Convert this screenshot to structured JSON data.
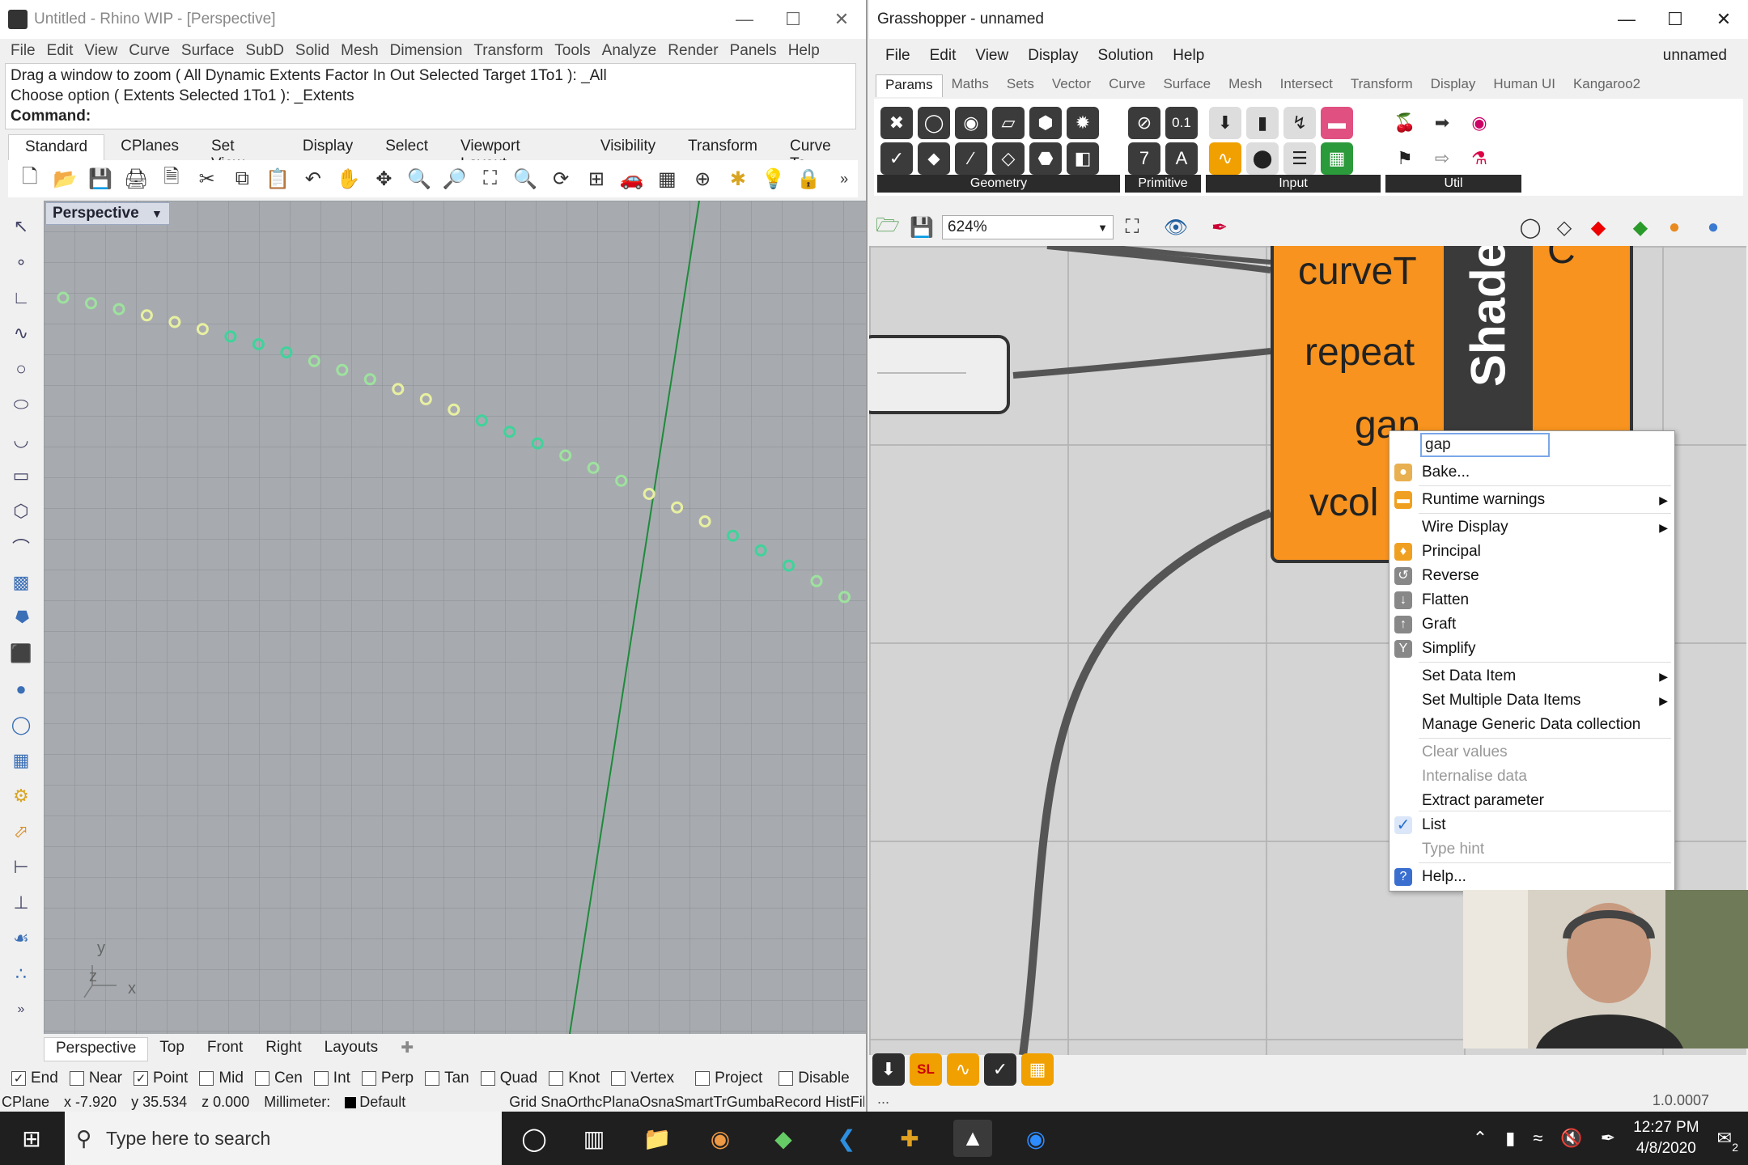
{
  "rhino": {
    "title": "Untitled - Rhino WIP - [Perspective]",
    "menu": [
      "File",
      "Edit",
      "View",
      "Curve",
      "Surface",
      "SubD",
      "Solid",
      "Mesh",
      "Dimension",
      "Transform",
      "Tools",
      "Analyze",
      "Render",
      "Panels",
      "Help"
    ],
    "command_history": [
      "Drag a window to zoom ( All  Dynamic  Extents  Factor  In  Out  Selected  Target  1To1 ): _All",
      "Choose option ( Extents  Selected  1To1 ): _Extents"
    ],
    "command_prompt": "Command:",
    "toolbar_tabs": [
      "Standard",
      "CPlanes",
      "Set View",
      "Display",
      "Select",
      "Viewport Layout",
      "Visibility",
      "Transform",
      "Curve To"
    ],
    "viewport_label": "Perspective",
    "axis_labels": {
      "y": "y",
      "z": "z",
      "x": "x"
    },
    "view_tabs": [
      "Perspective",
      "Top",
      "Front",
      "Right",
      "Layouts"
    ],
    "osnaps": [
      {
        "label": "End",
        "checked": true
      },
      {
        "label": "Near",
        "checked": false
      },
      {
        "label": "Point",
        "checked": true
      },
      {
        "label": "Mid",
        "checked": false
      },
      {
        "label": "Cen",
        "checked": false
      },
      {
        "label": "Int",
        "checked": false
      },
      {
        "label": "Perp",
        "checked": false
      },
      {
        "label": "Tan",
        "checked": false
      },
      {
        "label": "Quad",
        "checked": false
      },
      {
        "label": "Knot",
        "checked": false
      },
      {
        "label": "Vertex",
        "checked": false
      },
      {
        "label": "Project",
        "checked": false
      },
      {
        "label": "Disable",
        "checked": false
      }
    ],
    "status": {
      "cplane": "CPlanе",
      "x": "x -7.920",
      "y": "y 35.534",
      "z": "z 0.000",
      "units": "Millimeter:",
      "layer": "Default",
      "toggles": "Grid SnaOrthcPlanaOsnaSmartTrGumbaRecord HistFilt"
    },
    "point_colors": [
      "#9de29d",
      "#e8f0a0",
      "#3fd39a"
    ]
  },
  "grasshopper": {
    "title": "Grasshopper - unnamed",
    "menu": [
      "File",
      "Edit",
      "View",
      "Display",
      "Solution",
      "Help"
    ],
    "doc_name": "unnamed",
    "tabs": [
      "Params",
      "Maths",
      "Sets",
      "Vector",
      "Curve",
      "Surface",
      "Mesh",
      "Intersect",
      "Transform",
      "Display",
      "Human UI",
      "Kangaroo2"
    ],
    "groups": [
      "Geometry",
      "Primitive",
      "Input",
      "Util"
    ],
    "primitive_icons": [
      "0.1",
      "7",
      "A"
    ],
    "zoom": "624%",
    "component": {
      "inputs": [
        "curveT",
        "repeat",
        "gap",
        "vcol"
      ],
      "name": "Shade",
      "output": "C"
    },
    "context_menu": {
      "input_value": "gap",
      "items": [
        {
          "label": "Bake...",
          "enabled": true,
          "submenu": false,
          "icon": "bake-icon"
        },
        {
          "label": "Runtime warnings",
          "enabled": true,
          "submenu": true,
          "icon": "warning-icon"
        },
        {
          "label": "Wire Display",
          "enabled": true,
          "submenu": true,
          "icon": ""
        },
        {
          "label": "Principal",
          "enabled": true,
          "submenu": false,
          "icon": "principal-icon"
        },
        {
          "label": "Reverse",
          "enabled": true,
          "submenu": false,
          "icon": "reverse-icon"
        },
        {
          "label": "Flatten",
          "enabled": true,
          "submenu": false,
          "icon": "flatten-icon"
        },
        {
          "label": "Graft",
          "enabled": true,
          "submenu": false,
          "icon": "graft-icon"
        },
        {
          "label": "Simplify",
          "enabled": true,
          "submenu": false,
          "icon": "simplify-icon"
        },
        {
          "label": "Set Data Item",
          "enabled": true,
          "submenu": true,
          "icon": ""
        },
        {
          "label": "Set Multiple Data Items",
          "enabled": true,
          "submenu": true,
          "icon": ""
        },
        {
          "label": "Manage Generic Data collection",
          "enabled": true,
          "submenu": false,
          "icon": ""
        },
        {
          "label": "Clear values",
          "enabled": false,
          "submenu": false,
          "icon": ""
        },
        {
          "label": "Internalise data",
          "enabled": false,
          "submenu": false,
          "icon": ""
        },
        {
          "label": "Extract parameter",
          "enabled": true,
          "submenu": false,
          "icon": ""
        },
        {
          "label": "List",
          "enabled": true,
          "submenu": false,
          "checked": true,
          "icon": "check-icon"
        },
        {
          "label": "Type hint",
          "enabled": false,
          "submenu": false,
          "icon": ""
        },
        {
          "label": "Help...",
          "enabled": true,
          "submenu": false,
          "icon": "help-icon"
        }
      ]
    },
    "bottom_icons": [
      "SL"
    ],
    "status_left": "...",
    "version": "1.0.0007",
    "component_color": "#f7931e"
  },
  "taskbar": {
    "search_placeholder": "Type here to search",
    "time": "12:27 PM",
    "date": "4/8/2020",
    "notification_count": "2"
  }
}
